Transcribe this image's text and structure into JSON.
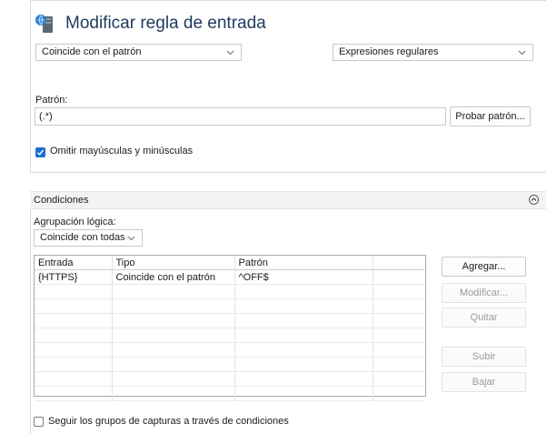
{
  "header": {
    "title": "Modificar regla de entrada",
    "icon": "server-rule-icon"
  },
  "match": {
    "selected": "Coincide con el patrón",
    "syntax_selected": "Expresiones regulares"
  },
  "pattern": {
    "label": "Patrón:",
    "value": "(.*)",
    "test_button": "Probar patrón..."
  },
  "ignore_case": {
    "label": "Omitir mayúsculas y minúsculas",
    "checked": true
  },
  "conditions": {
    "section_title": "Condiciones",
    "grouping_label": "Agrupación lógica:",
    "grouping_selected": "Coincide con todas",
    "columns": [
      "Entrada",
      "Tipo",
      "Patrón",
      ""
    ],
    "rows": [
      [
        "{HTTPS}",
        "Coincide con el patrón",
        "^OFF$",
        ""
      ]
    ],
    "buttons": {
      "add": "Agregar...",
      "edit": "Modificar...",
      "remove": "Quitar",
      "up": "Subir",
      "down": "Bajar"
    },
    "track_captures": {
      "label": "Seguir los grupos de capturas a través de condiciones",
      "checked": false
    }
  },
  "colors": {
    "accent": "#1c6fd1",
    "title": "#1e3a5f"
  }
}
